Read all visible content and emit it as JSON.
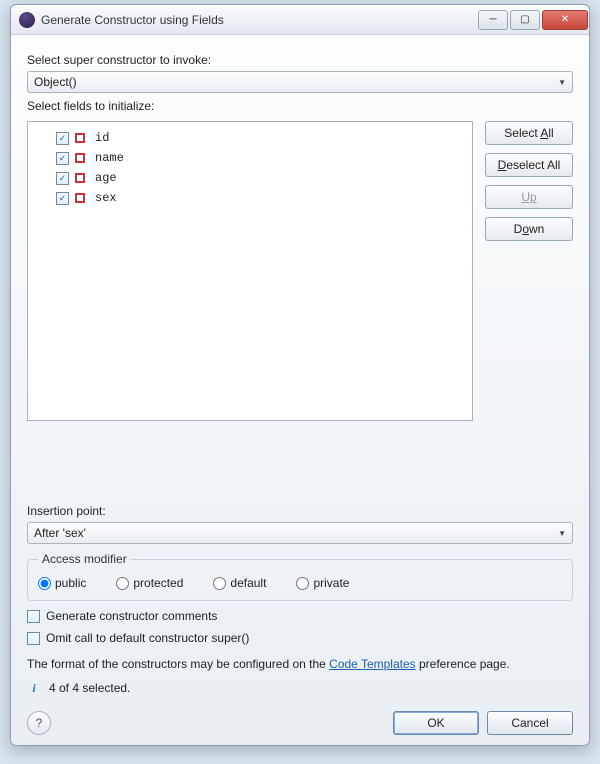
{
  "window": {
    "title": "Generate Constructor using Fields"
  },
  "labels": {
    "select_super": "Select super constructor to invoke:",
    "select_fields": "Select fields to initialize:",
    "insertion_point": "Insertion point:",
    "access_modifier": "Access modifier"
  },
  "combos": {
    "super_constructor": "Object()",
    "insertion_point": "After 'sex'"
  },
  "fields": [
    {
      "name": "id",
      "checked": true
    },
    {
      "name": "name",
      "checked": true
    },
    {
      "name": "age",
      "checked": true
    },
    {
      "name": "sex",
      "checked": true
    }
  ],
  "sidebar": {
    "select_all": "Select All",
    "deselect_all": "Deselect All",
    "up": "Up",
    "down": "Down"
  },
  "access": {
    "public": "public",
    "protected": "protected",
    "default": "default",
    "private": "private",
    "selected": "public"
  },
  "checkboxes": {
    "generate_comments": "Generate constructor comments",
    "omit_super": "Omit call to default constructor super()"
  },
  "note": {
    "prefix": "The format of the constructors may be configured on the ",
    "link": "Code Templates",
    "suffix": " preference page."
  },
  "status": "4 of 4 selected.",
  "buttons": {
    "ok": "OK",
    "cancel": "Cancel"
  }
}
